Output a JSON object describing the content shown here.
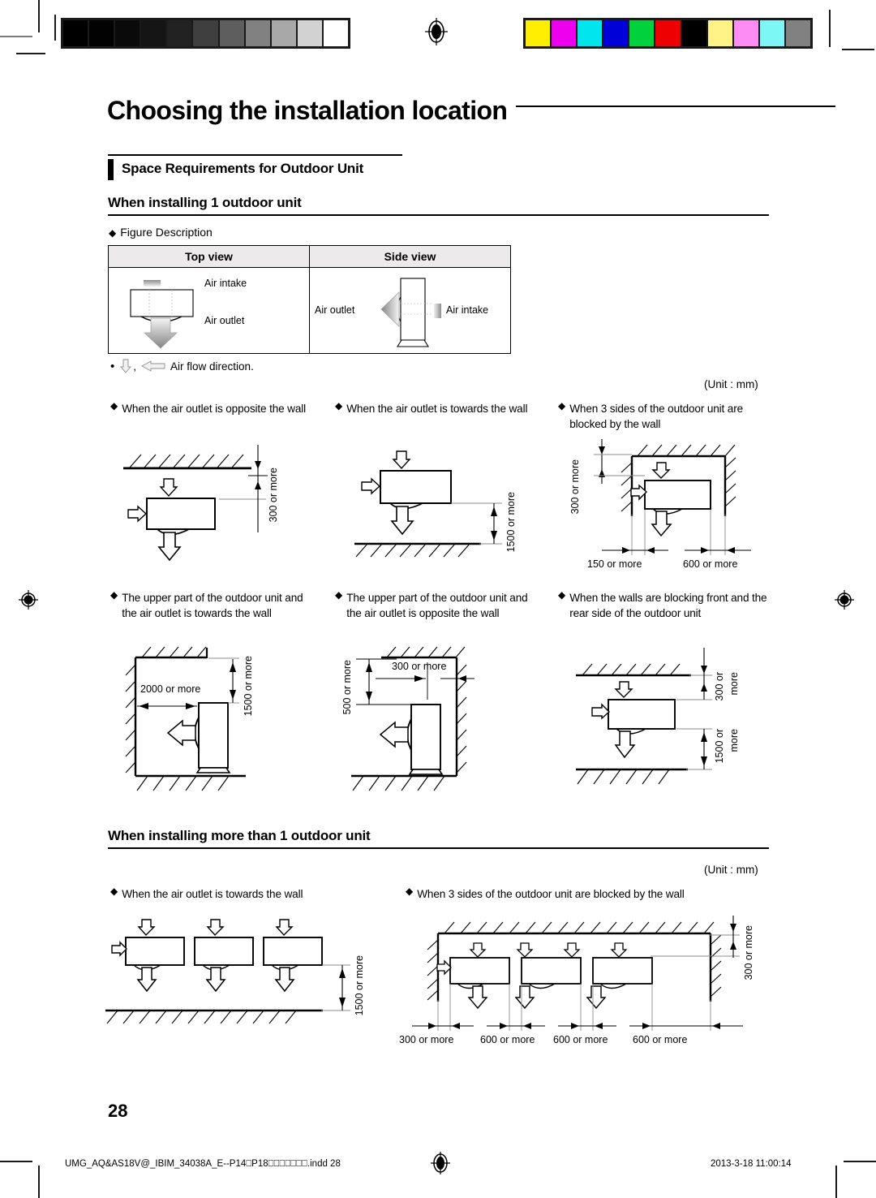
{
  "page": {
    "chapter_title": "Choosing the installation location",
    "section_title": "Space Requirements for Outdoor Unit",
    "page_number": "28"
  },
  "subsections": {
    "one_unit": {
      "title": "When installing 1 outdoor unit",
      "unit_note": "(Unit : mm)"
    },
    "multi_unit": {
      "title": "When installing more than 1 outdoor unit",
      "unit_note": "(Unit : mm)"
    }
  },
  "figure_description": {
    "bullet": "◆",
    "label": "Figure Description",
    "columns": [
      "Top view",
      "Side view"
    ],
    "top_view": {
      "air_intake": "Air intake",
      "air_outlet": "Air outlet"
    },
    "side_view": {
      "air_outlet": "Air outlet",
      "air_intake": "Air intake"
    },
    "flow_note": "Air flow direction."
  },
  "diagrams_one_unit": [
    {
      "bullet": "◆",
      "caption": "When the air outlet is opposite the wall",
      "dims": [
        "300 or more"
      ]
    },
    {
      "bullet": "◆",
      "caption": "When the air outlet is towards the wall",
      "dims": [
        "1500 or more"
      ]
    },
    {
      "bullet": "◆",
      "caption": "When 3 sides of the outdoor unit are blocked by the wall",
      "dims": [
        "300 or more",
        "150 or more",
        "600 or more"
      ]
    },
    {
      "bullet": "◆",
      "caption": "The upper part of the outdoor unit and the air outlet is towards the wall",
      "dims": [
        "2000 or more",
        "1500 or more"
      ]
    },
    {
      "bullet": "◆",
      "caption": "The upper part of the outdoor unit and the air outlet is opposite the wall",
      "dims": [
        "500 or more",
        "300 or more"
      ]
    },
    {
      "bullet": "◆",
      "caption": "When the walls are blocking front and the rear side of the outdoor unit",
      "dims": [
        "300 or more",
        "1500 or more"
      ]
    }
  ],
  "diagrams_multi_unit": [
    {
      "bullet": "◆",
      "caption": "When the air outlet is towards the wall",
      "dims": [
        "1500 or more"
      ]
    },
    {
      "bullet": "◆",
      "caption": "When 3 sides of the outdoor unit are blocked by the wall",
      "dims": [
        "300 or more",
        "300 or more",
        "600 or more",
        "600 or more",
        "600 or more"
      ]
    }
  ],
  "dim_labels": {
    "d300": "300 or more",
    "d300_a": "300 or",
    "d300_b": "more",
    "d150": "150 or more",
    "d500": "500 or more",
    "d600": "600 or more",
    "d1500": "1500 or more",
    "d1500_a": "1500 or",
    "d1500_b": "more",
    "d2000": "2000 or more"
  },
  "footer": {
    "file": "UMG_AQ&AS18V@_IBIM_34038A_E--P14⎕P18⎕⎕⎕⎕⎕⎕⎕.indd   28",
    "timestamp": "2013-3-18   11:00:14"
  },
  "colorbars": {
    "grayscale": [
      "#000000",
      "#020202",
      "#0a0a0a",
      "#151515",
      "#222222",
      "#3f3f3f",
      "#5e5e5e",
      "#818181",
      "#a8a8a8",
      "#d2d2d2",
      "#ffffff"
    ],
    "process": [
      "#ffee00",
      "#ee00ee",
      "#00e5ee",
      "#0000d8",
      "#00d13c",
      "#ee0000",
      "#000000",
      "#fff388",
      "#ff8cf5",
      "#7df6f6",
      "#818181"
    ]
  }
}
